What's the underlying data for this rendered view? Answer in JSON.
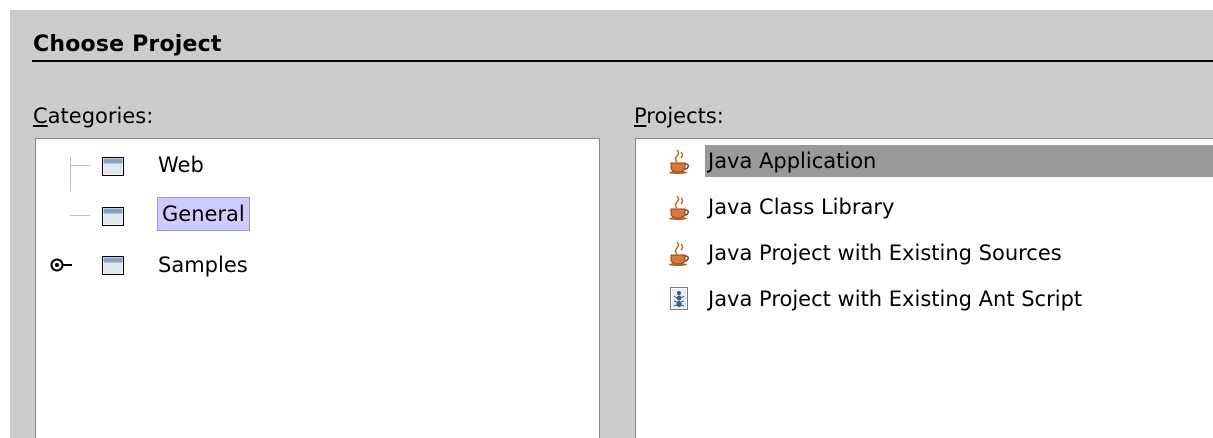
{
  "header": {
    "title": "Choose Project"
  },
  "categories": {
    "label_mnemonic": "C",
    "label_rest": "ategories:",
    "items": [
      {
        "label": "Web",
        "icon": "folder-icon",
        "selected": false
      },
      {
        "label": "General",
        "icon": "folder-icon",
        "selected": true
      },
      {
        "label": "Samples",
        "icon": "folder-icon",
        "selected": false,
        "expandable": true
      }
    ]
  },
  "projects": {
    "label_mnemonic": "P",
    "label_rest": "rojects:",
    "items": [
      {
        "label": "Java Application",
        "icon": "java-cup-icon",
        "selected": true
      },
      {
        "label": "Java Class Library",
        "icon": "java-cup-icon",
        "selected": false
      },
      {
        "label": "Java Project with Existing Sources",
        "icon": "java-cup-icon",
        "selected": false
      },
      {
        "label": "Java Project with Existing Ant Script",
        "icon": "ant-script-icon",
        "selected": false
      }
    ]
  },
  "colors": {
    "dialog_bg": "#cccccc",
    "selection_category": "#ccccff",
    "selection_project": "#999999"
  }
}
